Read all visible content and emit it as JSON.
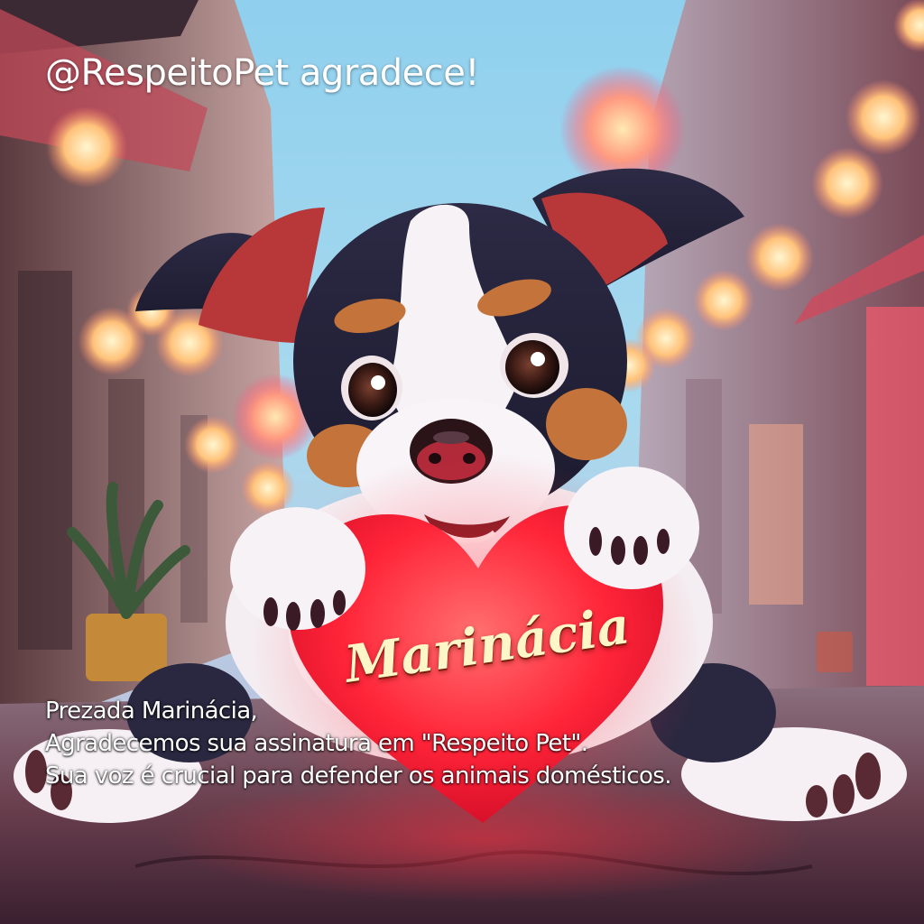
{
  "header": {
    "text": "@RespeitoPet agradece!"
  },
  "heart": {
    "name": "Marinácia"
  },
  "message": {
    "line1": "Prezada Marinácia,",
    "line2": "Agradecemos sua assinatura em \"Respeito Pet\".",
    "line3": "Sua voz é crucial para defender os animais domésticos."
  },
  "colors": {
    "heart": "#ff2a3a",
    "sky": "#9fd3ee",
    "text": "#ffffff",
    "name_text": "#fdf6c8"
  },
  "icons": [
    "puppy-illustration",
    "heart-sign",
    "lantern"
  ]
}
